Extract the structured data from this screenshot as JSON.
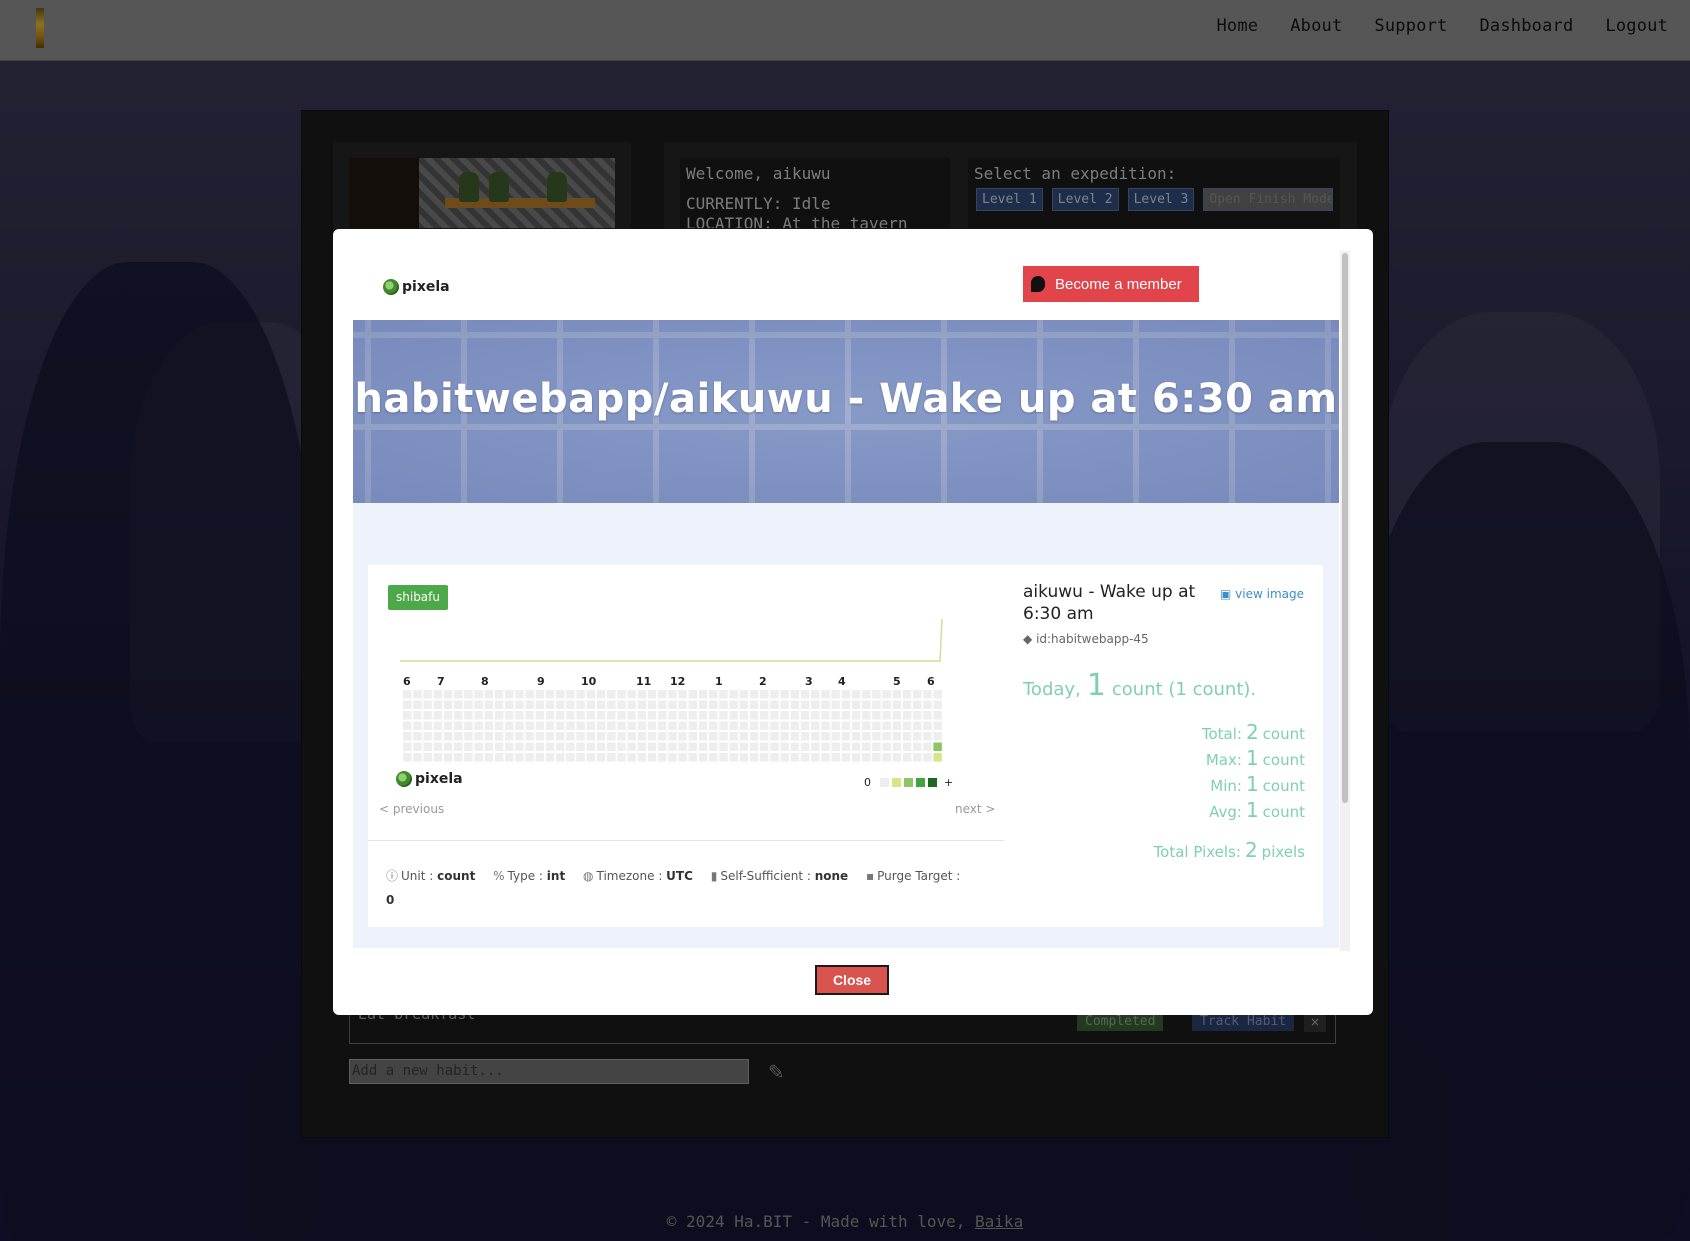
{
  "nav": {
    "links": [
      "Home",
      "About",
      "Support",
      "Dashboard",
      "Logout"
    ]
  },
  "background": {
    "welcome": "Welcome, aikuwu",
    "currently": "CURRENTLY: Idle",
    "location": "LOCATION: At the tavern",
    "expedition_label": "Select an expedition:",
    "levels": [
      "Level 1",
      "Level 2",
      "Level 3"
    ],
    "open_finish_mode": "Open Finish Mode",
    "habit_name": "Eat breakfast",
    "completed": "Completed",
    "track_habit": "Track Habit",
    "remove": "×",
    "new_habit_placeholder": "Add a new habit...",
    "footer_text": "© 2024 Ha.BIT - Made with love, ",
    "footer_link": "Baika"
  },
  "modal": {
    "logo_text": "pixela",
    "member_button": "Become a member",
    "hero_title": "habitwebapp/aikuwu - Wake up at 6:30 am",
    "badge": "shibafu",
    "months": [
      "6",
      "7",
      "8",
      "9",
      "10",
      "11",
      "12",
      "1",
      "2",
      "3",
      "4",
      "5",
      "6"
    ],
    "legend_min": "0",
    "legend_max": "+",
    "legend_colors": [
      "#eeeeee",
      "#d6e685",
      "#8cc665",
      "#44a340",
      "#1e6823"
    ],
    "previous": "< previous",
    "next": "next >",
    "meta": {
      "unit_label": "Unit",
      "unit": "count",
      "type_label": "Type",
      "type": "int",
      "timezone_label": "Timezone",
      "timezone": "UTC",
      "self_sufficient_label": "Self-Sufficient",
      "self_sufficient": "none",
      "purge_label": "Purge Target",
      "purge": "0"
    },
    "info": {
      "title": "aikuwu - Wake up at 6:30 am",
      "view_image": "view image",
      "id": "id:habitwebapp-45",
      "today_label": "Today",
      "today_value": "1",
      "today_suffix": "count (1 count).",
      "total_label": "Total:",
      "total": "2",
      "max_label": "Max:",
      "max": "1",
      "min_label": "Min:",
      "min": "1",
      "avg_label": "Avg:",
      "avg": "1",
      "unit": "count",
      "total_pixels_label": "Total Pixels:",
      "total_pixels": "2",
      "pixels_unit": "pixels"
    },
    "close": "Close"
  },
  "chart_data": {
    "type": "heatmap",
    "weeks": 53,
    "days_per_week": 7,
    "filled": [
      {
        "week": 52,
        "day": 5,
        "level": 2
      },
      {
        "week": 52,
        "day": 6,
        "level": 1
      }
    ],
    "line": {
      "values_last_weeks": [
        0,
        0,
        1
      ]
    }
  }
}
